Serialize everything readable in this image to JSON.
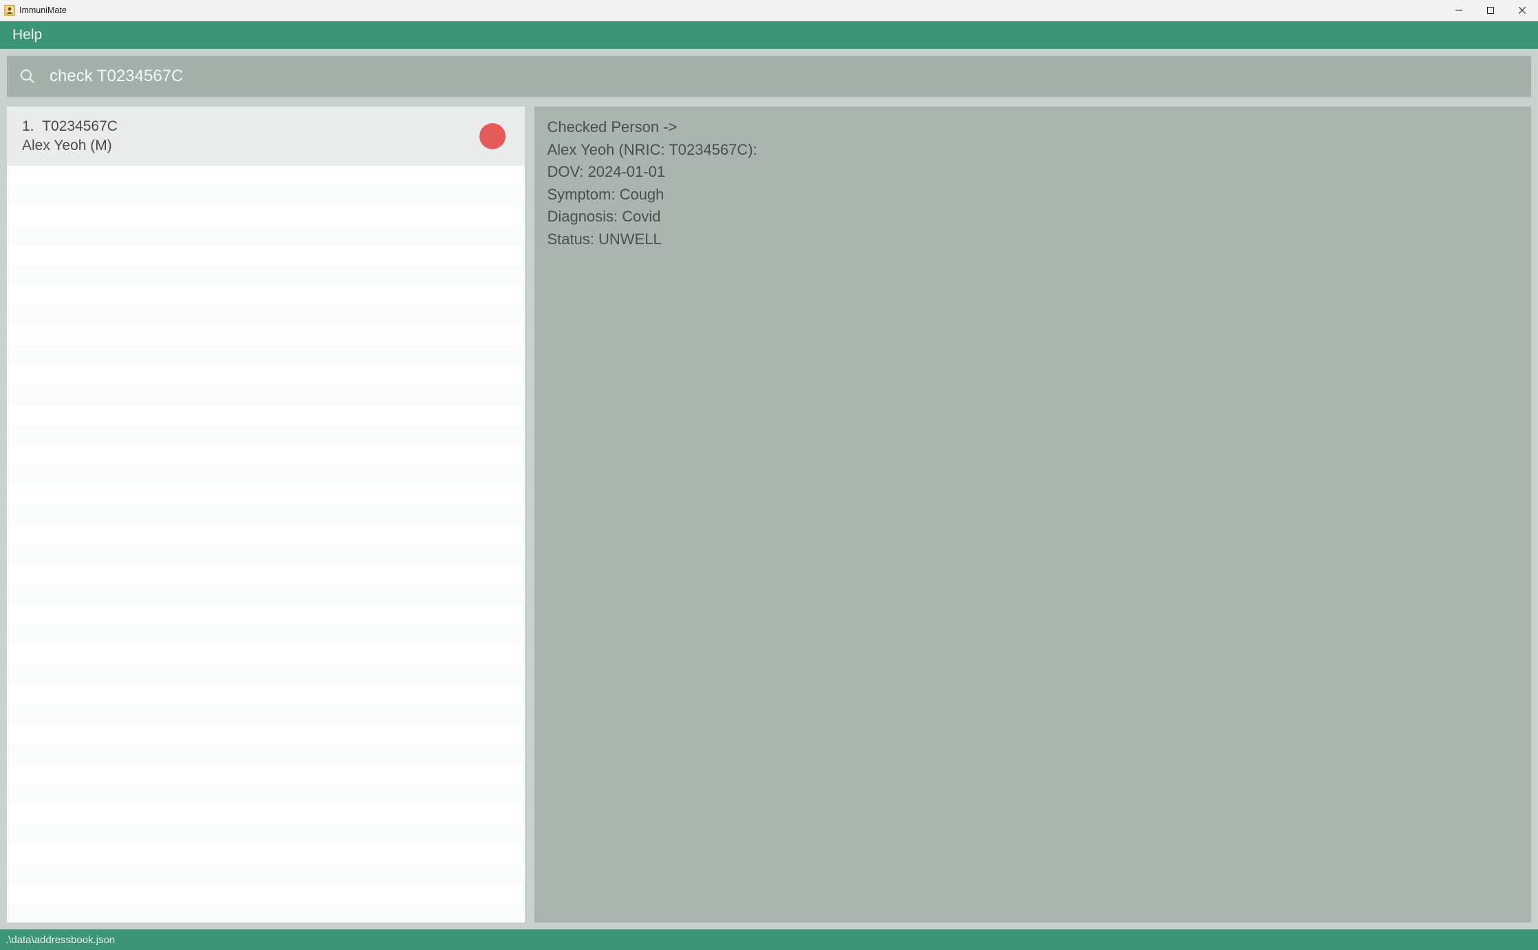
{
  "window": {
    "title": "ImmuniMate"
  },
  "menu": {
    "help_label": "Help"
  },
  "search": {
    "value": "check T0234567C",
    "placeholder": ""
  },
  "list": {
    "items": [
      {
        "index": "1.",
        "nric": "T0234567C",
        "name_line": "Alex Yeoh (M)",
        "status_color": "#e35a5a"
      }
    ]
  },
  "detail": {
    "lines": [
      "Checked Person ->",
      "Alex Yeoh (NRIC: T0234567C):",
      "DOV: 2024-01-01",
      "Symptom: Cough",
      "Diagnosis: Covid",
      "Status: UNWELL"
    ]
  },
  "statusbar": {
    "path": ".\\data\\addressbook.json"
  }
}
